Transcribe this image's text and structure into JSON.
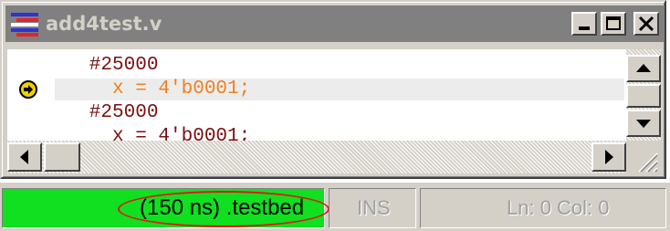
{
  "window": {
    "title": "add4test.v",
    "controls": {
      "minimize": "minimize",
      "maximize": "maximize",
      "close": "close"
    }
  },
  "editor": {
    "lines": [
      {
        "indent": "   ",
        "delay": "#25000"
      },
      {
        "indent": "     ",
        "code": "x = 4'b0001;",
        "current": true
      },
      {
        "indent": "   ",
        "delay": "#25000"
      },
      {
        "indent": "     ",
        "code": "x = 4'b0001;"
      }
    ],
    "line1": "   #25000",
    "line2": "     x = 4'b0001;",
    "line3": "   #25000",
    "line4": "     x = 4'b0001;",
    "current_line_marker_icon": "execution-arrow-icon"
  },
  "statusbar": {
    "simulation": "(150 ns) .testbed",
    "mode": "INS",
    "position": "Ln: 0  Col: 0"
  },
  "colors": {
    "titlebar_inactive": "#808080",
    "status_green": "#10e020",
    "current_line_text": "#f08020",
    "code_text": "#7a1010",
    "annotation_red": "#e01818"
  }
}
